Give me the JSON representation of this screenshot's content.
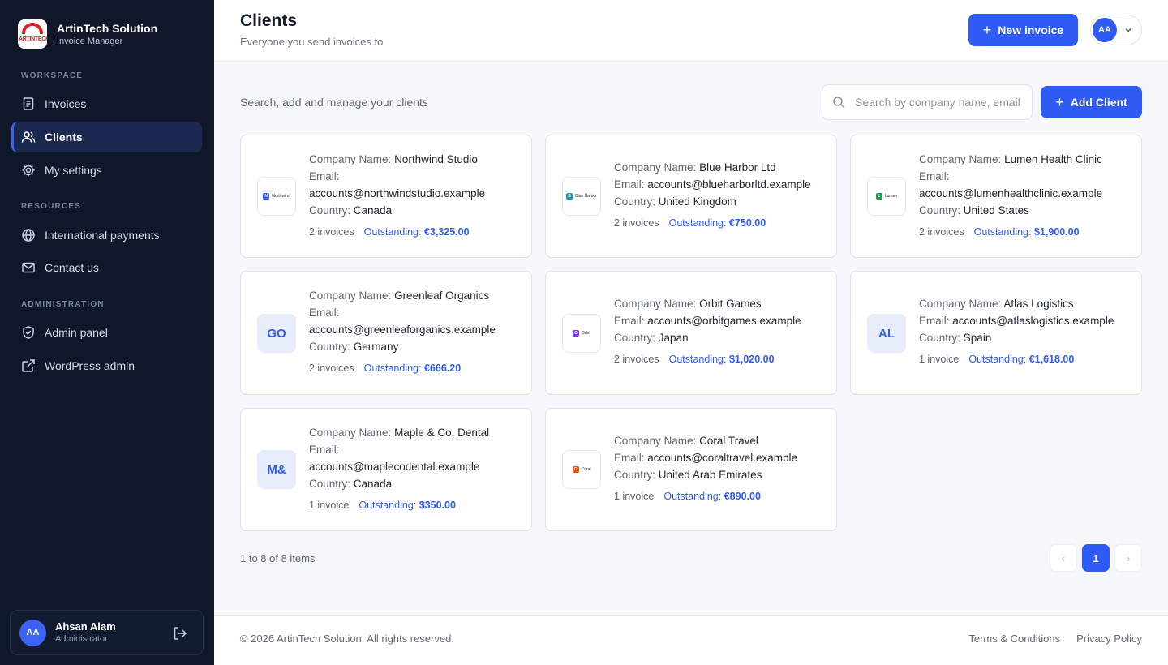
{
  "brand": {
    "name": "ArtinTech Solution",
    "subtitle": "Invoice Manager",
    "logo_text": "ARTINTECH"
  },
  "sidebar": {
    "sections": [
      {
        "label": "WORKSPACE"
      },
      {
        "label": "RESOURCES"
      },
      {
        "label": "ADMINISTRATION"
      }
    ],
    "items": [
      {
        "label": "Invoices",
        "icon": "invoice-icon"
      },
      {
        "label": "Clients",
        "icon": "users-icon",
        "active": true
      },
      {
        "label": "My settings",
        "icon": "gear-icon"
      },
      {
        "label": "International payments",
        "icon": "globe-icon"
      },
      {
        "label": "Contact us",
        "icon": "mail-icon"
      },
      {
        "label": "Admin panel",
        "icon": "shield-icon"
      },
      {
        "label": "WordPress admin",
        "icon": "external-link-icon"
      }
    ],
    "user": {
      "initials": "AA",
      "name": "Ahsan Alam",
      "role": "Administrator"
    }
  },
  "header": {
    "title": "Clients",
    "subtitle": "Everyone you send invoices to",
    "new_invoice_label": "New invoice",
    "profile_initials": "AA"
  },
  "toolbar": {
    "description": "Search, add and manage your clients",
    "search_placeholder": "Search by company name, email",
    "add_client_label": "Add Client"
  },
  "labels": {
    "company": "Company Name:",
    "email": "Email:",
    "country": "Country:",
    "outstanding": "Outstanding:"
  },
  "clients": [
    {
      "company": "Northwind Studio",
      "email": "accounts@northwindstudio.example",
      "country": "Canada",
      "invoices": "2 invoices",
      "outstanding": "€3,325.00",
      "logo_text": "Northwind",
      "logo_letter": "N",
      "logo_color": "#2f5bf5"
    },
    {
      "company": "Blue Harbor Ltd",
      "email": "accounts@blueharborltd.example",
      "country": "United Kingdom",
      "invoices": "2 invoices",
      "outstanding": "€750.00",
      "logo_text": "Blue Harbor",
      "logo_letter": "B",
      "logo_color": "#1f97b4"
    },
    {
      "company": "Lumen Health Clinic",
      "email": "accounts@lumenhealthclinic.example",
      "country": "United States",
      "invoices": "2 invoices",
      "outstanding": "$1,900.00",
      "logo_text": "Lumen",
      "logo_letter": "L",
      "logo_color": "#1f9a4a"
    },
    {
      "company": "Greenleaf Organics",
      "email": "accounts@greenleaforganics.example",
      "country": "Germany",
      "invoices": "2 invoices",
      "outstanding": "€666.20",
      "initials": "GO"
    },
    {
      "company": "Orbit Games",
      "email": "accounts@orbitgames.example",
      "country": "Japan",
      "invoices": "2 invoices",
      "outstanding": "$1,020.00",
      "logo_text": "Orbit",
      "logo_letter": "O",
      "logo_color": "#7c3aed"
    },
    {
      "company": "Atlas Logistics",
      "email": "accounts@atlaslogistics.example",
      "country": "Spain",
      "invoices": "1 invoice",
      "outstanding": "€1,618.00",
      "initials": "AL"
    },
    {
      "company": "Maple & Co. Dental",
      "email": "accounts@maplecodental.example",
      "country": "Canada",
      "invoices": "1 invoice",
      "outstanding": "$350.00",
      "initials": "M&"
    },
    {
      "company": "Coral Travel",
      "email": "accounts@coraltravel.example",
      "country": "United Arab Emirates",
      "invoices": "1 invoice",
      "outstanding": "€890.00",
      "logo_text": "Coral",
      "logo_letter": "C",
      "logo_color": "#ea580c"
    }
  ],
  "pagination": {
    "summary": "1 to 8 of 8 items",
    "current_page": "1",
    "prev": "‹",
    "next": "›"
  },
  "footer": {
    "copyright": "© 2026 ArtinTech Solution. All rights reserved.",
    "terms": "Terms & Conditions",
    "privacy": "Privacy Policy"
  },
  "colors": {
    "accent": "#2f5bf5",
    "sidebar_bg": "#0f1729",
    "active_item_bg": "#1b2850"
  }
}
